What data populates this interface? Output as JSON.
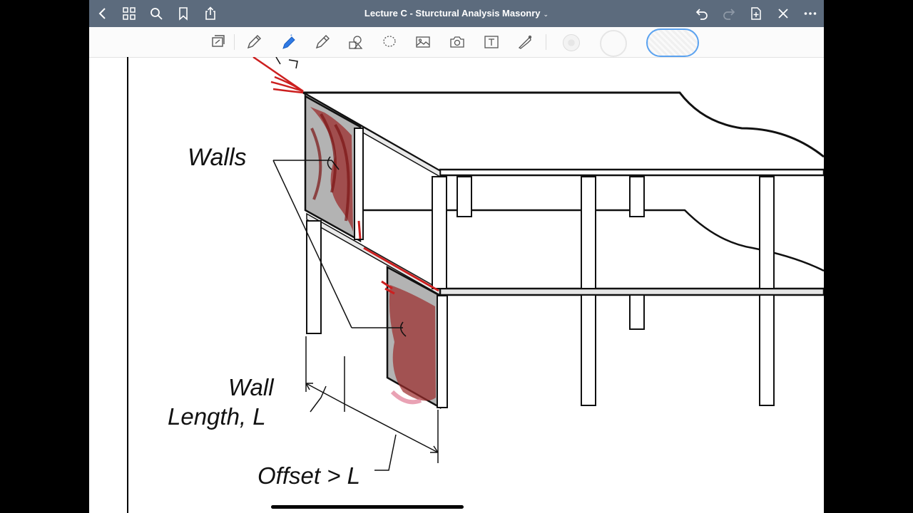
{
  "topbar": {
    "title": "Lecture C - Sturctural Analysis Masonry",
    "title_chevron": "⌄"
  },
  "figure": {
    "walls_label": "Walls",
    "wall_length_line1": "Wall",
    "wall_length_line2": "Length, L",
    "offset_label": "Offset > L"
  },
  "colors": {
    "topbar_bg": "#5c6b7d",
    "accent_blue": "#2f7ae5",
    "annotation_red": "#cc1f1f"
  }
}
